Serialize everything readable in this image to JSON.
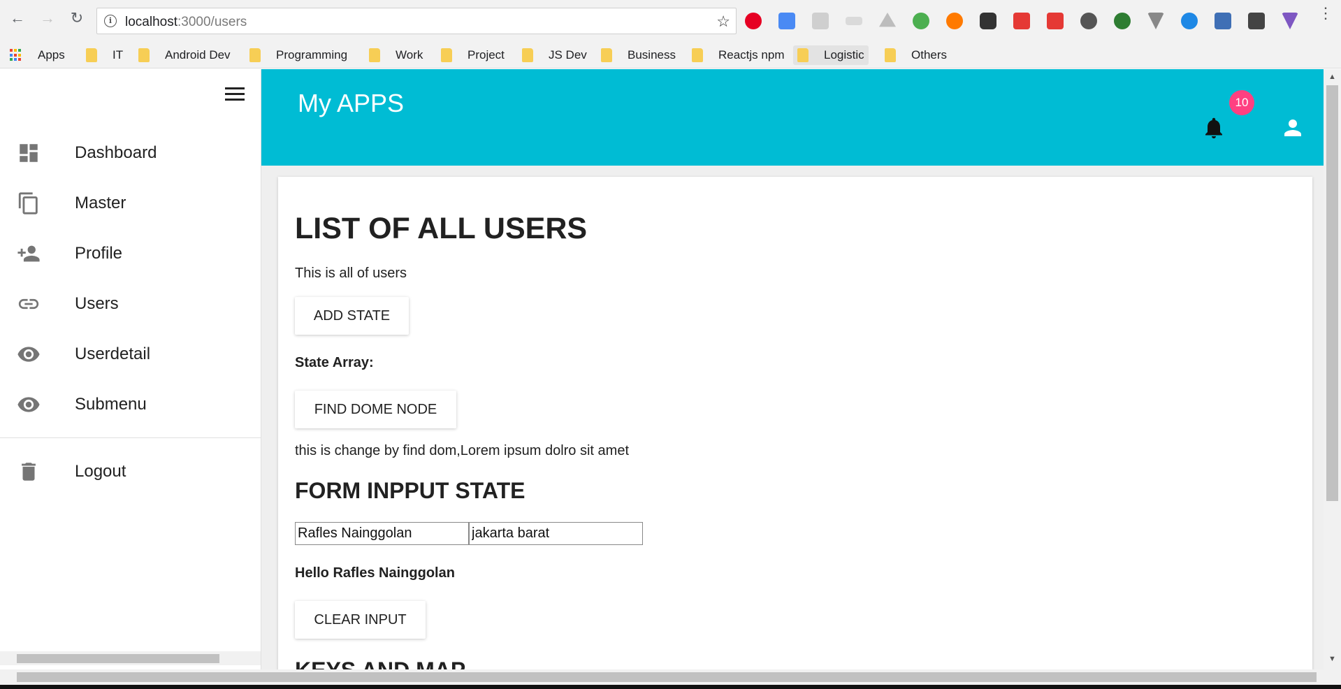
{
  "browser": {
    "url_host": "localhost",
    "url_path": ":3000/users",
    "bookmarks": [
      "Apps",
      "IT",
      "Android Dev",
      "Programming",
      "Work",
      "Project",
      "JS Dev",
      "Business",
      "Reactjs npm",
      "Logistic",
      "Others"
    ]
  },
  "appbar": {
    "title": "My APPS",
    "notification_count": "10"
  },
  "sidebar": {
    "items": [
      {
        "label": "Dashboard",
        "icon": "dashboard-icon"
      },
      {
        "label": "Master",
        "icon": "copy-icon"
      },
      {
        "label": "Profile",
        "icon": "person-add-icon"
      },
      {
        "label": "Users",
        "icon": "link-icon"
      },
      {
        "label": "Userdetail",
        "icon": "eye-icon"
      },
      {
        "label": "Submenu",
        "icon": "eye-icon"
      }
    ],
    "logout": "Logout"
  },
  "content": {
    "title": "LIST OF ALL USERS",
    "subtitle": "This is all of users",
    "add_state_button": "ADD STATE",
    "state_array_label": "State Array:",
    "find_dom_button": "FIND DOME NODE",
    "find_dom_text": "this is change by find dom,Lorem ipsum dolro sit amet",
    "form_heading": "FORM INPPUT STATE",
    "name_value": "Rafles Nainggolan",
    "city_value": "jakarta barat",
    "hello_text": "Hello Rafles Nainggolan",
    "clear_button": "CLEAR INPUT",
    "next_heading": "KEYS AND MAP"
  },
  "colors": {
    "appbar": "#00bcd4",
    "badge": "#ff4081"
  }
}
